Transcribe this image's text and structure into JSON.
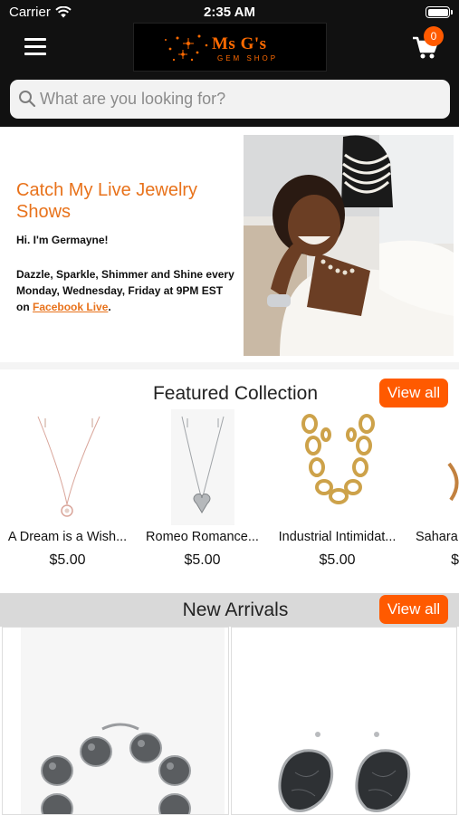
{
  "status_bar": {
    "carrier": "Carrier",
    "time": "2:35 AM"
  },
  "header": {
    "logo_main": "Ms G's",
    "logo_sub": "GEM SHOP",
    "cart_count": "0"
  },
  "search": {
    "placeholder": "What are you looking for?"
  },
  "hero": {
    "title": "Catch My Live Jewelry Shows",
    "greeting": "Hi. I'm Germayne!",
    "body": "Dazzle, Sparkle, Shimmer and Shine every Monday, Wednesday, Friday at 9PM EST on",
    "link": "Facebook Live",
    "after_link": "."
  },
  "featured": {
    "title": "Featured Collection",
    "view_all": "View all",
    "products": [
      {
        "name": "A Dream is a Wish...",
        "price": "$5.00"
      },
      {
        "name": "Romeo Romance...",
        "price": "$5.00"
      },
      {
        "name": "Industrial Intimidat...",
        "price": "$5.00"
      },
      {
        "name": "Sahara",
        "price": "$"
      }
    ]
  },
  "new_arrivals": {
    "title": "New Arrivals",
    "view_all": "View all"
  },
  "colors": {
    "accent": "#ff5a00",
    "header_bg": "#111111",
    "title_orange": "#e8721b"
  }
}
